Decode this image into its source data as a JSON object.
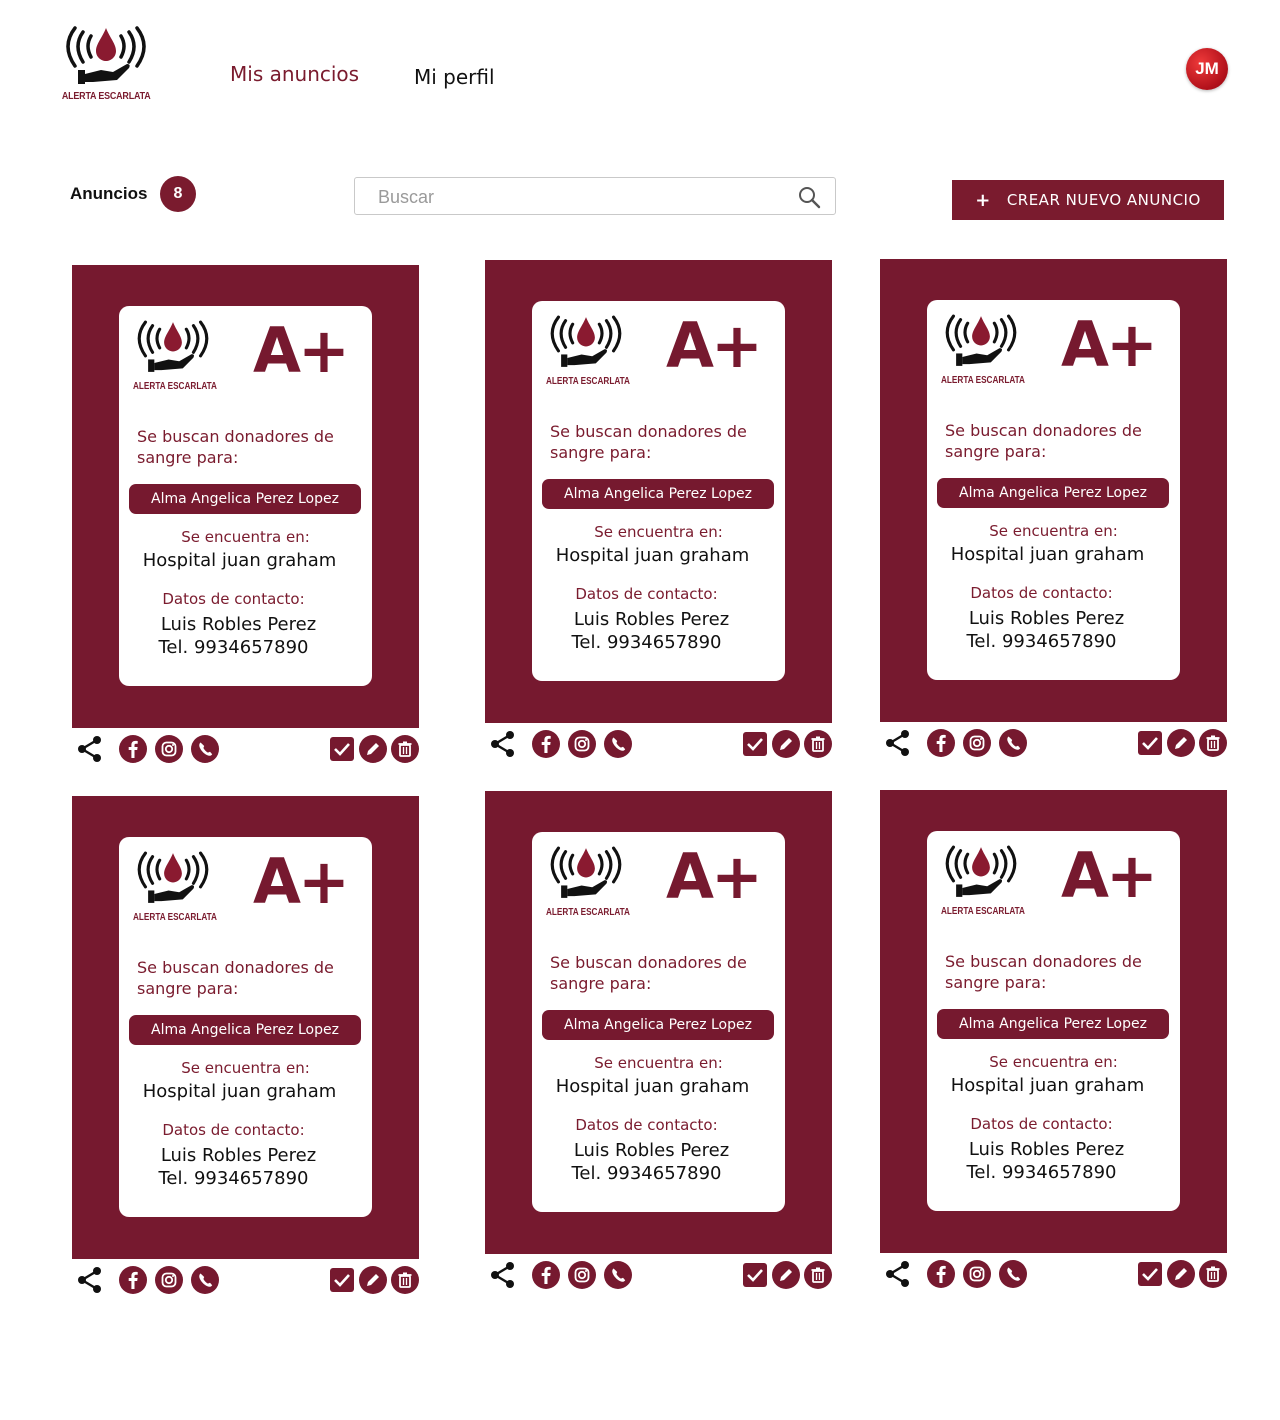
{
  "app": {
    "logo_text": "ALERTA ESCARLATA"
  },
  "nav": {
    "my_ads": "Mis anuncios",
    "my_profile": "Mi perfil"
  },
  "user": {
    "initials": "JM"
  },
  "toolbar": {
    "count_label": "Anuncios",
    "count": "8",
    "search_placeholder": "Buscar",
    "search_value": "",
    "create_label": "CREAR NUEVO ANUNCIO",
    "create_icon": "+"
  },
  "colors": {
    "brand": "#76192f",
    "accent": "#7a1b2e",
    "avatar": "#c8141e"
  },
  "icons": [
    "share-icon",
    "facebook-icon",
    "instagram-icon",
    "whatsapp-icon",
    "check-icon",
    "edit-icon",
    "delete-icon"
  ],
  "cards": [
    {
      "logo_text": "ALERTA ESCARLATA",
      "blood_type": "A+",
      "sought": "Se buscan donadores de sangre para:",
      "patient": "Alma Angelica Perez Lopez",
      "location_label": "Se encuentra en:",
      "location": "Hospital juan graham",
      "contact_label": "Datos de contacto:",
      "contact_name": "Luis Robles Perez",
      "contact_tel": "Tel. 9934657890"
    },
    {
      "logo_text": "ALERTA ESCARLATA",
      "blood_type": "A+",
      "sought": "Se buscan donadores de sangre para:",
      "patient": "Alma Angelica Perez Lopez",
      "location_label": "Se encuentra en:",
      "location": "Hospital juan graham",
      "contact_label": "Datos de contacto:",
      "contact_name": "Luis Robles Perez",
      "contact_tel": "Tel. 9934657890"
    },
    {
      "logo_text": "ALERTA ESCARLATA",
      "blood_type": "A+",
      "sought": "Se buscan donadores de sangre para:",
      "patient": "Alma Angelica Perez Lopez",
      "location_label": "Se encuentra en:",
      "location": "Hospital juan graham",
      "contact_label": "Datos de contacto:",
      "contact_name": "Luis Robles Perez",
      "contact_tel": "Tel. 9934657890"
    },
    {
      "logo_text": "ALERTA ESCARLATA",
      "blood_type": "A+",
      "sought": "Se buscan donadores de sangre para:",
      "patient": "Alma Angelica Perez Lopez",
      "location_label": "Se encuentra en:",
      "location": "Hospital juan graham",
      "contact_label": "Datos de contacto:",
      "contact_name": "Luis Robles Perez",
      "contact_tel": "Tel. 9934657890"
    },
    {
      "logo_text": "ALERTA ESCARLATA",
      "blood_type": "A+",
      "sought": "Se buscan donadores de sangre para:",
      "patient": "Alma Angelica Perez Lopez",
      "location_label": "Se encuentra en:",
      "location": "Hospital juan graham",
      "contact_label": "Datos de contacto:",
      "contact_name": "Luis Robles Perez",
      "contact_tel": "Tel. 9934657890"
    },
    {
      "logo_text": "ALERTA ESCARLATA",
      "blood_type": "A+",
      "sought": "Se buscan donadores de sangre para:",
      "patient": "Alma Angelica Perez Lopez",
      "location_label": "Se encuentra en:",
      "location": "Hospital juan graham",
      "contact_label": "Datos de contacto:",
      "contact_name": "Luis Robles Perez",
      "contact_tel": "Tel. 9934657890"
    }
  ]
}
